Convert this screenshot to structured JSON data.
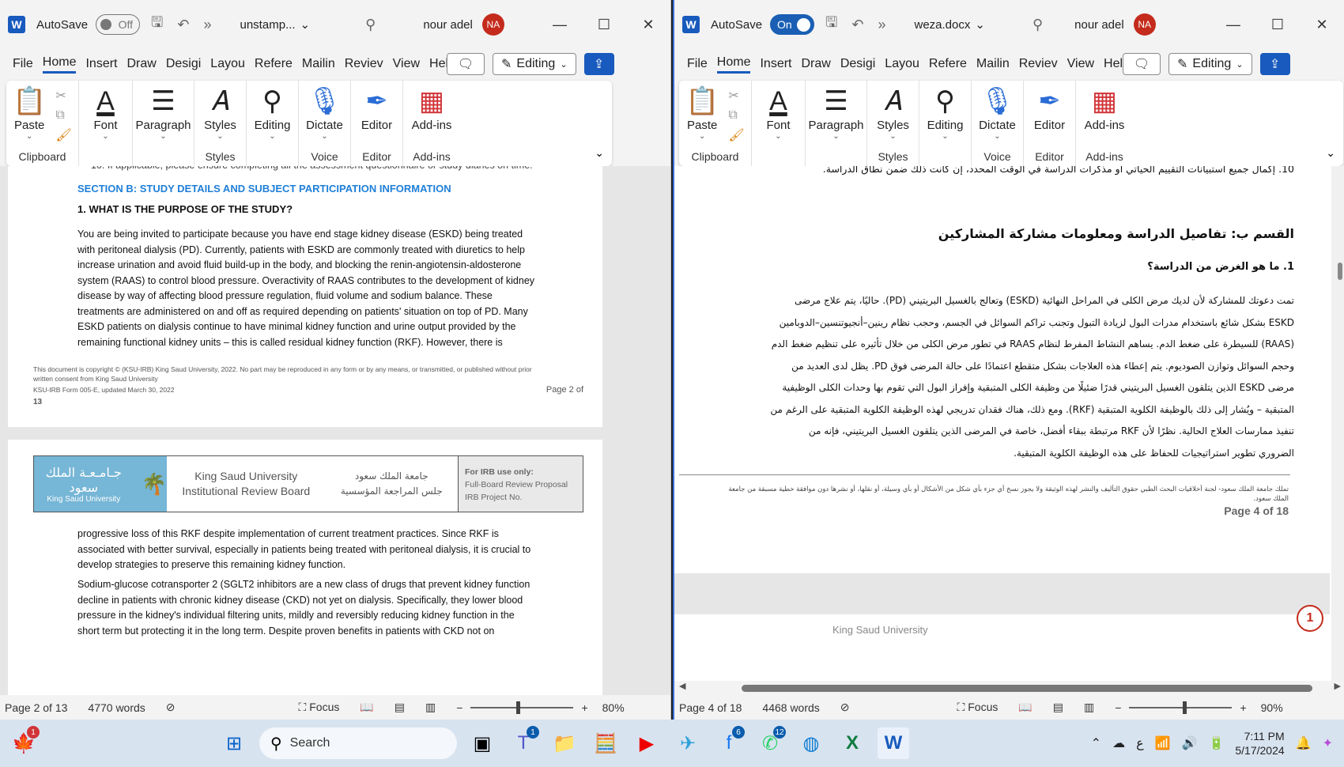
{
  "left_window": {
    "app": "W",
    "autosave_label": "AutoSave",
    "autosave_state": "Off",
    "doc_title": "unstamp...",
    "user": "nour adel",
    "avatar_initials": "NA",
    "menu": [
      "File",
      "Home",
      "Insert",
      "Draw",
      "Desigi",
      "Layou",
      "Refere",
      "Mailin",
      "Reviev",
      "View",
      "Help"
    ],
    "editing_label": "Editing",
    "ribbon": {
      "paste": "Paste",
      "font": "Font",
      "paragraph": "Paragraph",
      "styles": "Styles",
      "editing": "Editing",
      "dictate": "Dictate",
      "editor": "Editor",
      "addins": "Add-ins",
      "g_clipboard": "Clipboard",
      "g_styles": "Styles",
      "g_voice": "Voice",
      "g_editor": "Editor",
      "g_addins": "Add-ins"
    },
    "doc": {
      "top_cut": "10. If applicable, please ensure completing all the assessment questionnaire or study diaries on time.",
      "section_heading": "SECTION B: STUDY DETAILS AND SUBJECT PARTICIPATION INFORMATION",
      "q1": "1.  WHAT IS THE PURPOSE OF THE STUDY?",
      "para1_lines": [
        "You are being invited to participate because you have end stage kidney disease (ESKD) being treated",
        "with peritoneal dialysis (PD). Currently, patients with ESKD are commonly treated with diuretics to help",
        "increase urination and avoid fluid build-up in the body, and blocking the renin-angiotensin-aldosterone",
        "system (RAAS) to control blood pressure. Overactivity of RAAS contributes to the development of kidney",
        "disease by way of affecting blood pressure regulation, fluid volume and sodium balance. These",
        "treatments are administered on and off as required depending on patients' situation on top of PD. Many",
        "ESKD patients on dialysis continue to have minimal kidney function and urine output provided by the",
        "remaining functional kidney units – this is called residual kidney function (RKF). However, there is"
      ],
      "footer_line1": "This document is copyright © (KSU-IRB) King Saud University, 2022. No part may be reproduced in any form or by any means, or transmitted, or published without prior",
      "footer_line2": "written consent from King Saud University",
      "footer_line3": "KSU-IRB Form 005-E, updated March 30, 2022",
      "footer_page": "Page  2  of",
      "footer_total": "13",
      "header_logo_ar": "جـامـعـة الملك سعود",
      "header_logo_en": "King Saud University",
      "header_ksu_en1": "King Saud University",
      "header_ksu_en2": "Institutional Review Board",
      "header_ksu_ar1": "جامعة الملك سعود",
      "header_ksu_ar2": "جلس المراجعة المؤسسية",
      "irb_title": "For IRB use only:",
      "irb_line1": "Full-Board Review Proposal",
      "irb_line2": "IRB Project No.",
      "para2_lines": [
        "progressive loss of this RKF despite implementation of current treatment practices. Since RKF is",
        "associated with better survival, especially in patients being treated with peritoneal dialysis, it is crucial to",
        "develop strategies to preserve this remaining kidney function."
      ],
      "para3_lines": [
        "Sodium-glucose cotransporter 2 (SGLT2 inhibitors are a new class of drugs that prevent kidney function",
        "decline in patients with chronic kidney disease (CKD) not yet on dialysis. Specifically, they lower blood",
        "pressure in the kidney's individual filtering units, mildly and reversibly reducing kidney function in the",
        "short term but protecting it in the long term. Despite proven benefits in patients with CKD not on"
      ]
    },
    "status": {
      "page": "Page 2 of 13",
      "words": "4770 words",
      "focus": "Focus",
      "zoom": "80%"
    }
  },
  "right_window": {
    "app": "W",
    "autosave_label": "AutoSave",
    "autosave_state": "On",
    "doc_title": "weza.docx",
    "user": "nour adel",
    "avatar_initials": "NA",
    "menu": [
      "File",
      "Home",
      "Insert",
      "Draw",
      "Desigi",
      "Layou",
      "Refere",
      "Mailin",
      "Reviev",
      "View",
      "Help"
    ],
    "editing_label": "Editing",
    "ribbon": {
      "paste": "Paste",
      "font": "Font",
      "paragraph": "Paragraph",
      "styles": "Styles",
      "editing": "Editing",
      "dictate": "Dictate",
      "editor": "Editor",
      "addins": "Add-ins",
      "g_clipboard": "Clipboard",
      "g_styles": "Styles",
      "g_voice": "Voice",
      "g_editor": "Editor",
      "g_addins": "Add-ins"
    },
    "doc": {
      "item10": "10. إكمال جميع استبيانات التقييم الحياتي أو مذكرات الدراسة في الوقت المحدد، إن كانت ذلك ضمن نطاق الدراسة.",
      "section_heading": "القسم ب: تفاصيل الدراسة ومعلومات مشاركة المشاركين",
      "q1": "1. ما هو الغرض من الدراسة؟",
      "para_lines": [
        "تمت دعوتك للمشاركة لأن لديك مرض الكلى في المراحل النهائية (ESKD) وتعالج بالغسيل البريتيني (PD). حاليًا، يتم علاج مرضى",
        "ESKD بشكل شائع باستخدام مدرات البول لزيادة التبول وتجنب تراكم السوائل في الجسم، وحجب نظام رينين–أنجيوتنسين–الدوبامين",
        "(RAAS) للسيطرة على ضغط الدم. يساهم النشاط المفرط لنظام RAAS في تطور مرض الكلى من خلال تأثيره على تنظيم ضغط الدم",
        "وحجم السوائل وتوازن الصوديوم. يتم إعطاء هذه العلاجات بشكل متقطع اعتمادًا على حالة المرضى فوق PD. يظل لدى العديد من",
        "مرضى ESKD الذين يتلقون الغسيل البريتيني قدرًا ضئيلًا من وظيفة الكلى المتبقية وإفراز البول التي تقوم بها وحدات الكلى الوظيفية",
        "المتبقية – ويُشار إلى ذلك بالوظيفة الكلوية المتبقية (RKF). ومع ذلك، هناك فقدان تدريجي لهذه الوظيفة الكلوية المتبقية على الرغم من",
        "تنفيذ ممارسات العلاج الحالية. نظرًا لأن RKF مرتبطة ببقاء أفضل، خاصة في المرضى الذين يتلقون الغسيل البريتيني، فإنه من",
        "الضروري تطوير استراتيجيات للحفاظ على هذه الوظيفة الكلوية المتبقية."
      ],
      "footer_line1": "تملك جامعة الملك سعود- لجنة أخلاقيات البحث الطبي حقوق التأليف والنشر لهذه الوثيقة ولا يجوز نسخ أي جزء بأي شكل من الأشكال أو بأي وسيلة، أو نقلها، أو نشرها دون موافقة خطية مسبقة من جامعة",
      "footer_line2": "الملك سعود.",
      "footer_page": "Page 4 of 18",
      "next_header": "King Saud University",
      "marker": "1"
    },
    "status": {
      "page": "Page 4 of 18",
      "words": "4468 words",
      "focus": "Focus",
      "zoom": "90%"
    }
  },
  "taskbar": {
    "search_placeholder": "Search",
    "time": "7:11 PM",
    "date": "5/17/2024",
    "lang": "ع",
    "badges": {
      "start_notif": "1",
      "teams": "1",
      "facebook": "6",
      "whatsapp": "12"
    }
  }
}
